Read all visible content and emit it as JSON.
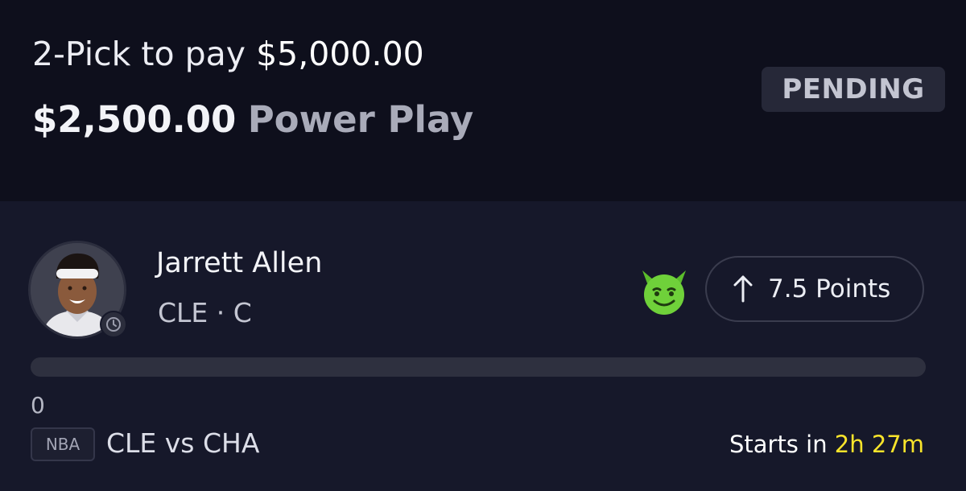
{
  "entry": {
    "pick_text": "2-Pick to pay",
    "payout": "$5,000.00",
    "stake": "$2,500.00",
    "play_type": "Power Play",
    "status": "PENDING"
  },
  "player": {
    "name": "Jarrett Allen",
    "team_position": "CLE · C",
    "pick_value": "7.5 Points",
    "direction": "up",
    "icon": "green-devil-emoji"
  },
  "progress": {
    "current": "0",
    "fraction": 0
  },
  "game": {
    "league": "NBA",
    "matchup": "CLE vs CHA",
    "starts_label": "Starts in",
    "countdown": "2h 27m"
  },
  "colors": {
    "countdown": "#f9e42b",
    "devil": "#6fd13a"
  }
}
